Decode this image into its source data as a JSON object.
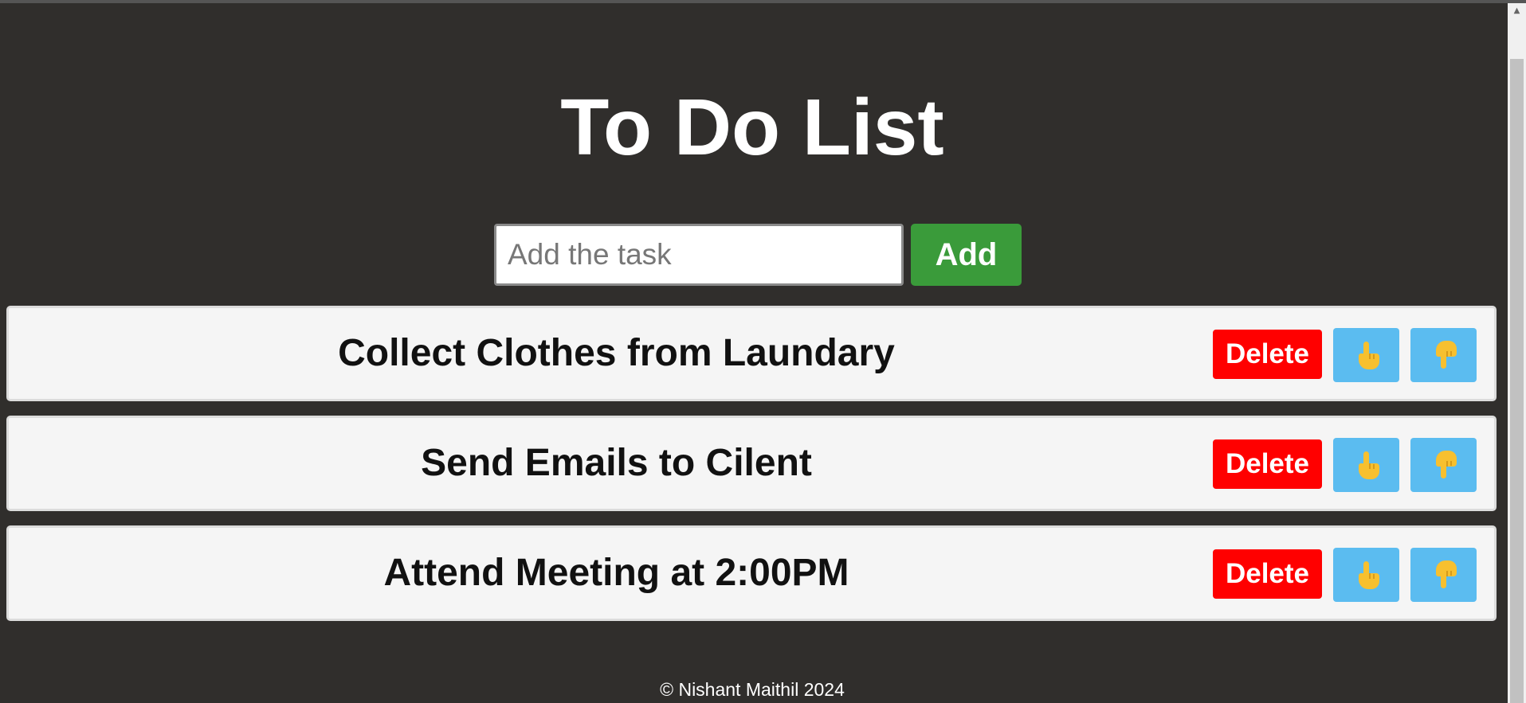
{
  "app": {
    "title": "To Do List"
  },
  "add_form": {
    "input_value": "",
    "placeholder": "Add the task",
    "add_label": "Add"
  },
  "tasks": [
    {
      "text": "Collect Clothes from Laundary",
      "delete_label": "Delete",
      "up_icon": "hand-pointing-up-icon",
      "down_icon": "hand-pointing-down-icon"
    },
    {
      "text": "Send Emails to Cilent",
      "delete_label": "Delete",
      "up_icon": "hand-pointing-up-icon",
      "down_icon": "hand-pointing-down-icon"
    },
    {
      "text": "Attend Meeting at 2:00PM",
      "delete_label": "Delete",
      "up_icon": "hand-pointing-up-icon",
      "down_icon": "hand-pointing-down-icon"
    }
  ],
  "footer": {
    "text": "© Nishant Maithil 2024"
  },
  "colors": {
    "background": "#302e2c",
    "add_button": "#3a9b3a",
    "delete_button": "#ff0000",
    "move_button": "#5bbcf0",
    "task_card": "#f5f5f5"
  }
}
